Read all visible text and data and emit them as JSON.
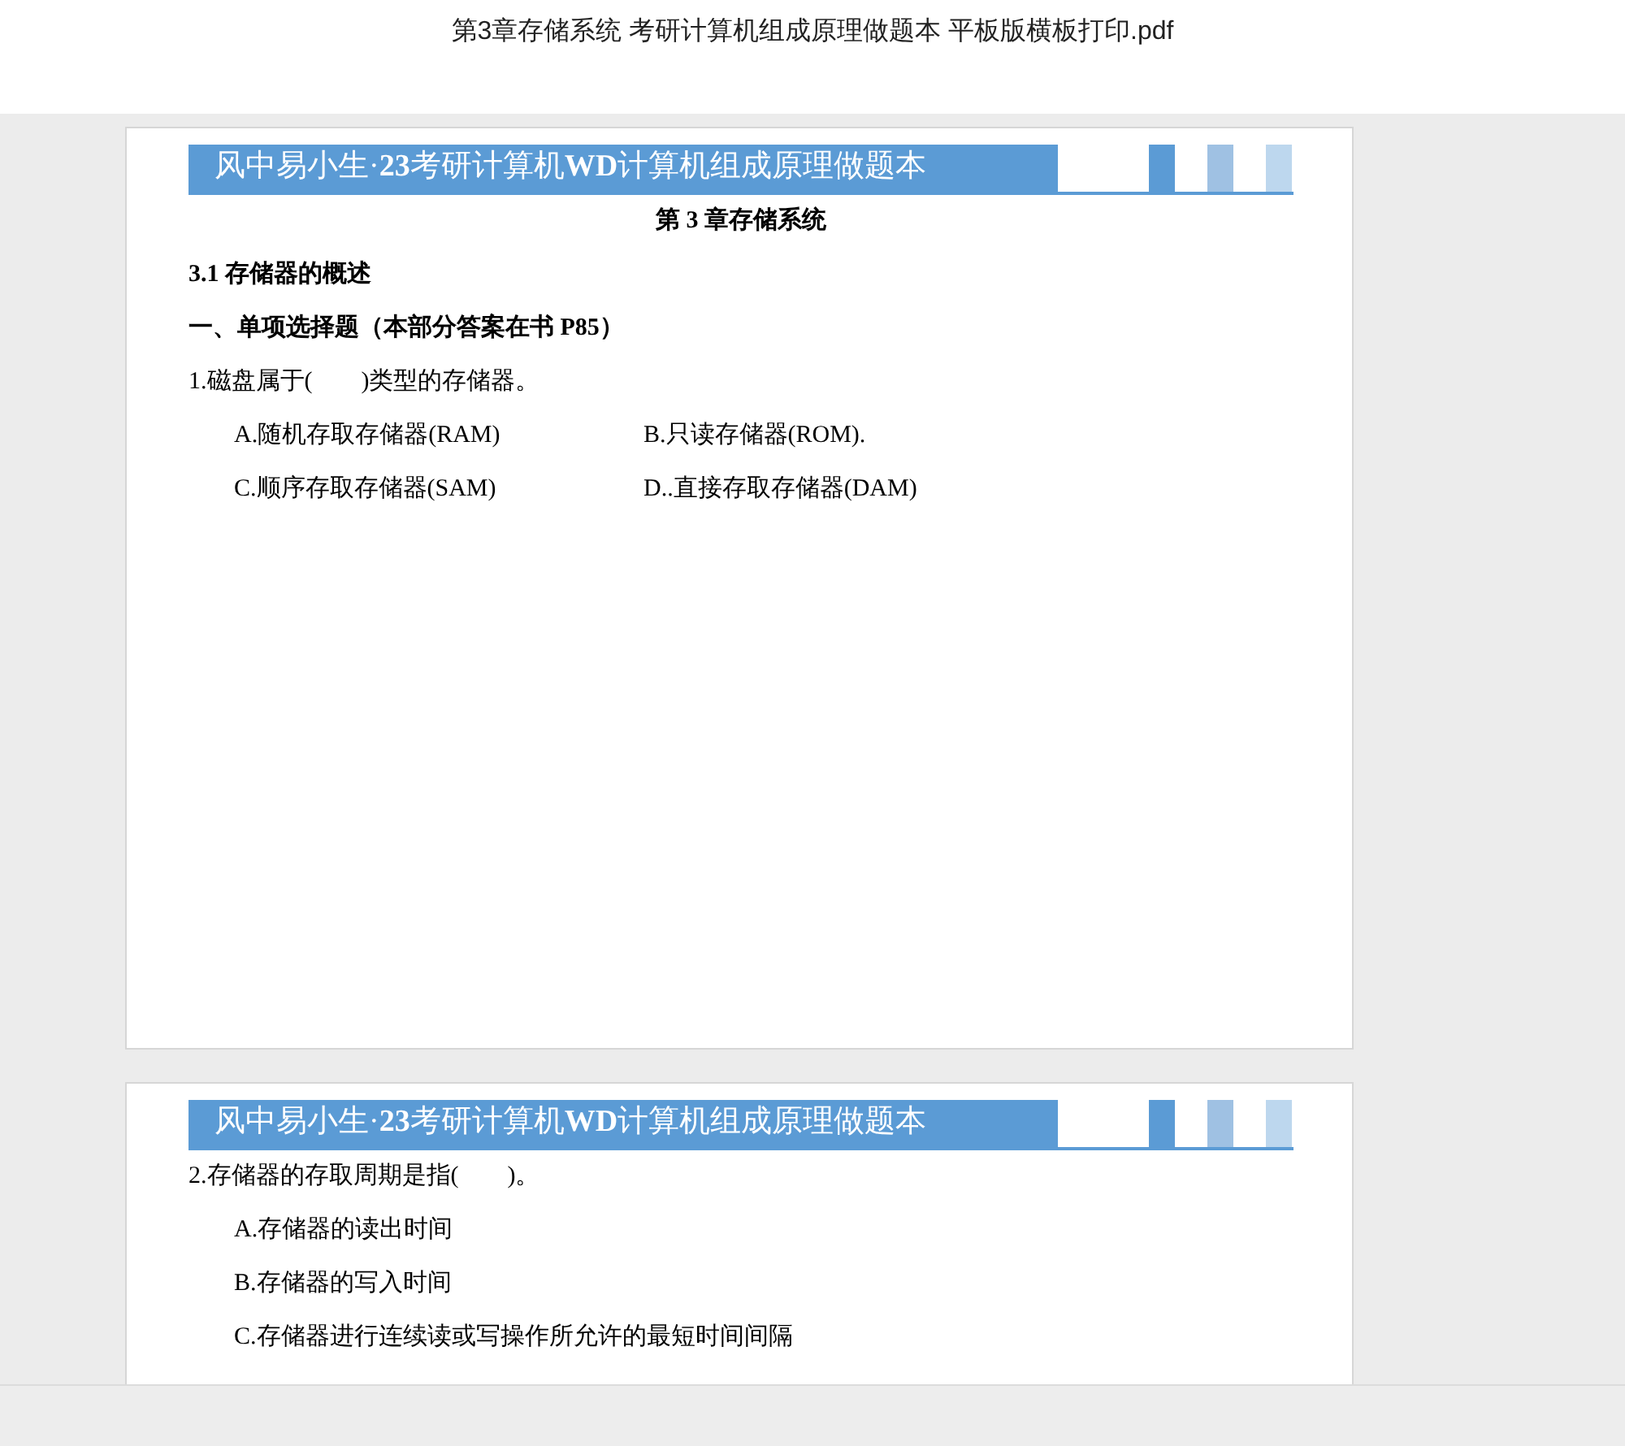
{
  "window": {
    "title": "第3章存储系统 考研计算机组成原理做题本 平板版横板打印.pdf"
  },
  "pages": [
    {
      "banner": "风中易小生·**23**考研计算机**WD**计算机组成原理做题本",
      "blocks": [
        {
          "kind": "chapter",
          "text": "第 3 章存储系统"
        },
        {
          "kind": "section",
          "text": "3.1 存储器的概述"
        },
        {
          "kind": "section",
          "text": "一、单项选择题（本部分答案在书 P85）"
        },
        {
          "kind": "question",
          "text": "1.磁盘属于(　　)类型的存储器。"
        },
        {
          "kind": "option_pair",
          "options": [
            "A.随机存取存储器(RAM)",
            "B.只读存储器(ROM)."
          ]
        },
        {
          "kind": "option_pair",
          "options": [
            "C.顺序存取存储器(SAM)",
            "D..直接存取存储器(DAM)"
          ]
        }
      ]
    },
    {
      "banner": "风中易小生·**23**考研计算机**WD**计算机组成原理做题本",
      "blocks": [
        {
          "kind": "question",
          "text": "2.存储器的存取周期是指(　　)。"
        },
        {
          "kind": "option",
          "text": "A.存储器的读出时间"
        },
        {
          "kind": "option",
          "text": "B.存储器的写入时间"
        },
        {
          "kind": "option",
          "text": "C.存储器进行连续读或写操作所允许的最短时间间隔"
        }
      ]
    }
  ]
}
